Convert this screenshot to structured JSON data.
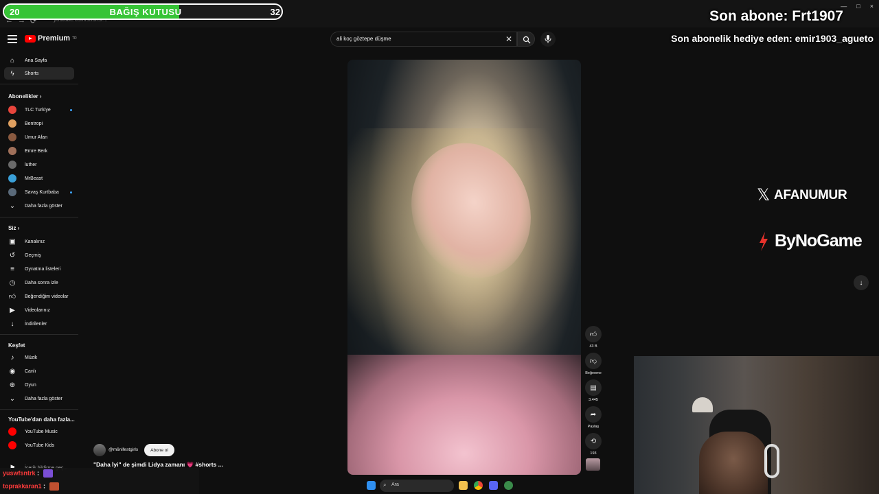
{
  "browser": {
    "url": "youtube.com/shorts/...",
    "window_controls": [
      "—",
      "□",
      "×"
    ]
  },
  "donation": {
    "title": "BAĞIŞ KUTUSU",
    "current": "20",
    "target": "32",
    "progress_fraction": 0.63,
    "bar_color": "#36c436"
  },
  "overlay": {
    "last_subscriber": "Son abone: Frt1907",
    "last_gift": "Son abonelik hediye eden: emir1903_agueto",
    "social_x": "AFANUMUR",
    "sponsor": "ByNoGame"
  },
  "youtube": {
    "logo": "Premium",
    "logo_sup": "TR",
    "search_value": "ali koç göztepe düşme",
    "search_icon": "search-icon",
    "mic_icon": "mic-icon"
  },
  "sidebar": {
    "top": [
      {
        "label": "Ana Sayfa",
        "icon": "home-icon"
      },
      {
        "label": "Shorts",
        "icon": "shorts-icon"
      }
    ],
    "subscriptions_header": "Abonelikler",
    "subscriptions": [
      {
        "label": "TLC Turkiye",
        "color": "#e8453c"
      },
      {
        "label": "Bentropi",
        "color": "#e0a060"
      },
      {
        "label": "Umur Afan",
        "color": "#8a5a40"
      },
      {
        "label": "Emre Berk",
        "color": "#a0705a"
      },
      {
        "label": "luther",
        "color": "#6a6a6a"
      },
      {
        "label": "MrBeast",
        "color": "#3aa0d8"
      },
      {
        "label": "Savaş Kurtbaba",
        "color": "#5a6a7a"
      },
      {
        "label": "Daha fazla göster",
        "color": ""
      }
    ],
    "you_header": "Siz",
    "you": [
      {
        "label": "Kanalınız",
        "icon": "channel-icon"
      },
      {
        "label": "Geçmiş",
        "icon": "history-icon"
      },
      {
        "label": "Oynatma listeleri",
        "icon": "playlist-icon"
      },
      {
        "label": "Daha sonra izle",
        "icon": "clock-icon"
      },
      {
        "label": "Beğendiğim videolar",
        "icon": "thumbs-up-icon"
      },
      {
        "label": "Videolarınız",
        "icon": "video-icon"
      },
      {
        "label": "İndirilenler",
        "icon": "download-icon"
      }
    ],
    "explore_header": "Keşfet",
    "explore": [
      {
        "label": "Müzik",
        "icon": "music-icon"
      },
      {
        "label": "Canlı",
        "icon": "live-icon"
      },
      {
        "label": "Oyun",
        "icon": "gamepad-icon"
      },
      {
        "label": "Daha fazla göster",
        "icon": "chevron-down-icon"
      }
    ],
    "more_header": "YouTube'dan daha fazla...",
    "more": [
      {
        "label": "YouTube Music",
        "color": "#ff0000"
      },
      {
        "label": "YouTube Kids",
        "color": "#ff0000"
      }
    ],
    "report_label": "İçerik bildirme geç..."
  },
  "short": {
    "channel": "@m6nifestgirls",
    "subscribe": "Abone ol",
    "title": "\"Daha İyi\" de şimdi Lidya zamanı 💗 #shorts ...",
    "likes": "43 B",
    "dislike_label": "Beğenme",
    "comments": "3.445",
    "share_label": "Paylaş",
    "remix_count": "193"
  },
  "chat": [
    {
      "user": "yuswfsntrk",
      "msg": ":"
    },
    {
      "user": "toprakkaran1",
      "msg": ":"
    }
  ],
  "taskbar": {
    "search_placeholder": "Ara"
  }
}
